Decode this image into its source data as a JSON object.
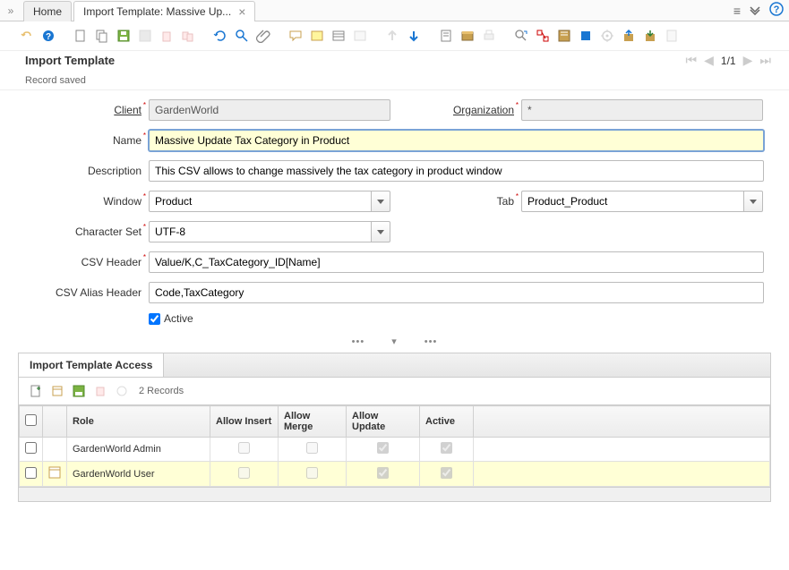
{
  "tabs": {
    "home": "Home",
    "current": "Import Template: Massive Up..."
  },
  "toolbar_pager": "1/1",
  "window_title": "Import Template",
  "status": "Record saved",
  "labels": {
    "client": "Client",
    "organization": "Organization",
    "name": "Name",
    "description": "Description",
    "window": "Window",
    "tab": "Tab",
    "charset": "Character Set",
    "csvheader": "CSV Header",
    "csvalias": "CSV Alias Header",
    "active": "Active"
  },
  "values": {
    "client": "GardenWorld",
    "organization": "*",
    "name": "Massive Update Tax Category in Product",
    "description": "This CSV allows to change massively the tax category in product window",
    "window": "Product",
    "tab": "Product_Product",
    "charset": "UTF-8",
    "csvheader": "Value/K,C_TaxCategory_ID[Name]",
    "csvalias": "Code,TaxCategory"
  },
  "detail_tab": "Import Template Access",
  "records_label": "2 Records",
  "grid": {
    "headers": {
      "role": "Role",
      "allowinsert": "Allow Insert",
      "allowmerge": "Allow Merge",
      "allowupdate": "Allow Update",
      "active": "Active"
    },
    "rows": [
      {
        "role": "GardenWorld Admin",
        "insert": false,
        "merge": false,
        "update": true,
        "active": true,
        "selected": false
      },
      {
        "role": "GardenWorld User",
        "insert": false,
        "merge": false,
        "update": true,
        "active": true,
        "selected": true
      }
    ]
  }
}
